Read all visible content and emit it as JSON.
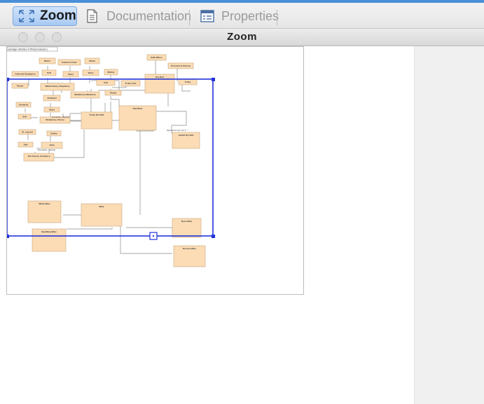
{
  "tabs": {
    "zoom_label": "Zoom",
    "documentation_label": "Documentation",
    "properties_label": "Properties"
  },
  "window": {
    "title": "Zoom"
  },
  "diagram": {
    "header": "package Varieties of Wine[ Example ]",
    "nodes": [
      "Merlot",
      "Cabernet Franc",
      "Shiraz",
      "Bulk Wines",
      "Cabernet Sauvignon",
      "Soft",
      "Spicy",
      "Spicy",
      "Mellow",
      "Dry Red",
      "Overtone & Finesse",
      "Tannin",
      "Black Cherry, Raspberry",
      "Soft",
      "Fruity Acid",
      "Fruity",
      "Blackberry Blueberry",
      "Tannin",
      "Zinfandel",
      "Grenache",
      "Spicy",
      "Fruity Dry Red",
      "Red Wine",
      "Soft",
      "Strawberry, Cherry",
      "Herbal Dry Red",
      "St. Laurent",
      "Earthy",
      "Soft",
      "Juicy",
      "Tart Cherry, Cranberry",
      "White Wine",
      "Wine",
      "Rose Wine",
      "Sparkling Wine",
      "Dessert Wine"
    ],
    "edge_labels": [
      "{complete, disjoint}",
      "{complete, disjoint}",
      "high tannin dry red 1...*"
    ]
  },
  "colors": {
    "accent": "#2233dd",
    "node_fill": "#fbdcb5",
    "node_stroke": "#c9a77e",
    "tab_active": "#a9c9f2"
  }
}
